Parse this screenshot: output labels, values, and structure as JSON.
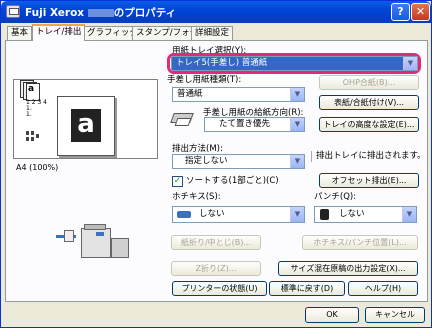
{
  "window": {
    "title_brand": "Fuji Xerox",
    "title_suffix": "のプロパティ",
    "help_label": "?",
    "close_label": "✕"
  },
  "tabs": [
    "基本",
    "トレイ/排出",
    "グラフィックス",
    "スタンプ/フォーム",
    "詳細設定"
  ],
  "active_tab": 1,
  "preview": {
    "paper_letter": "a",
    "caption": "A4 (100%)",
    "tray_label_a": "a",
    "tray_numbers": "1 2 3 4\n1.\n1."
  },
  "tray": {
    "label": "用紙トレイ選択(Y):",
    "selected": "トレイ5(手差し)        普通紙",
    "ohp_button": "OHP合紙(B)..."
  },
  "bypass_type": {
    "label": "手差し用紙種類(T):",
    "value": "普通紙"
  },
  "bypass_orientation": {
    "label": "手差し用紙の給紙方向(R):",
    "value": "たて置き優先"
  },
  "buttons": {
    "cover": "表紙/合紙付け(V)...",
    "tray_priority": "トレイの高度な設定(E)...",
    "offset": "オフセット排出(E)...",
    "fold": "紙折り/中とじ(B)...",
    "staple_pos": "ホチキス/パンチ位置(L)...",
    "zfold": "Z折り(Z)...",
    "size_mix": "サイズ混在原稿の出力設定(X)...",
    "printer_status": "プリンターの状態(U)",
    "restore": "標準に戻す(D)",
    "help": "ヘルプ(H)",
    "ok": "OK",
    "cancel": "キャンセル"
  },
  "output": {
    "label": "排出方法(M):",
    "value": "指定しない",
    "note": "排出トレイに排出されます。"
  },
  "sort": {
    "label": "ソートする(1部ごと)(C)",
    "checked": true
  },
  "staple": {
    "label": "ホチキス(S):",
    "value": "しない"
  },
  "punch": {
    "label": "パンチ(Q):",
    "value": "しない"
  },
  "colors": {
    "highlight_ring": "#e6287a",
    "selected_bg": "#316ac5",
    "titlebar": "#0046d5"
  }
}
